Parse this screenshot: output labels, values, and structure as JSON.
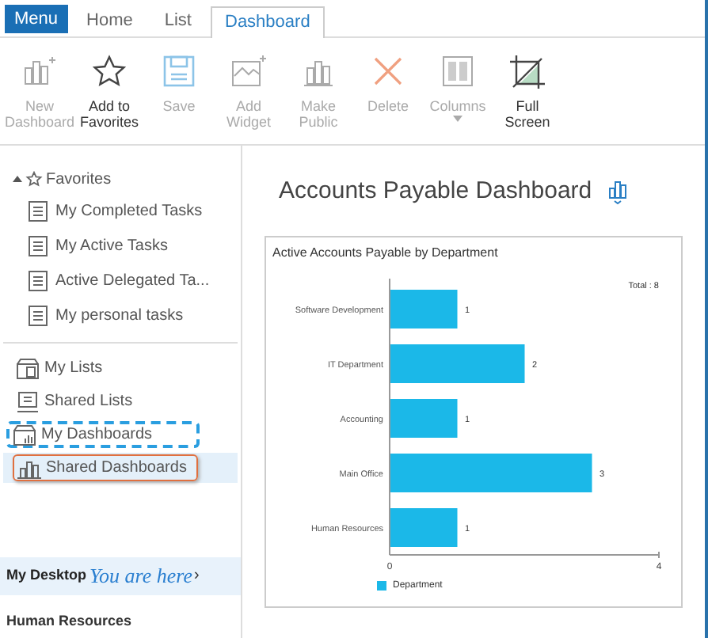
{
  "tabs": [
    {
      "label": "Menu",
      "kind": "menu",
      "selected": false
    },
    {
      "label": "Home",
      "kind": "tab",
      "selected": false
    },
    {
      "label": "List",
      "kind": "tab",
      "selected": false
    },
    {
      "label": "Dashboard",
      "kind": "tab",
      "selected": true
    }
  ],
  "toolbar": [
    {
      "label": "New Dashboard",
      "disabled": true
    },
    {
      "label": "Add to Favorites",
      "disabled": false
    },
    {
      "label": "Save",
      "disabled": true
    },
    {
      "label": "Add Widget",
      "disabled": true
    },
    {
      "label": "Make Public",
      "disabled": true
    },
    {
      "label": "Delete",
      "disabled": true
    },
    {
      "label": "Columns",
      "disabled": true,
      "dropdown": true
    },
    {
      "label": "Full Screen",
      "disabled": false
    }
  ],
  "sidebar": {
    "favorites": {
      "label": "Favorites",
      "expanded": true,
      "items": [
        "My Completed Tasks",
        "My Active Tasks",
        "Active Delegated Ta...",
        "My personal tasks"
      ]
    },
    "items": [
      {
        "label": "My Lists",
        "selected": false
      },
      {
        "label": "Shared Lists",
        "selected": false
      },
      {
        "label": "My Dashboards",
        "selected": false,
        "highlighted": true
      },
      {
        "label": "Shared Dashboards",
        "selected": true
      }
    ],
    "desktop": {
      "label": "My Desktop",
      "note": "You are here",
      "chevron": "›"
    },
    "section": "Human Resources"
  },
  "main": {
    "title": "Accounts Payable Dashboard",
    "widget": {
      "chart_data": {
        "type": "bar",
        "orientation": "horizontal",
        "title": "Active Accounts Payable by Department",
        "categories": [
          "Software Development",
          "IT Department",
          "Accounting",
          "Main Office",
          "Human Resources"
        ],
        "series": [
          {
            "name": "Department",
            "color": "#1bb8e8",
            "values": [
              1,
              2,
              1,
              3,
              1
            ]
          }
        ],
        "xlim": [
          0,
          4
        ],
        "xticks": [
          0,
          4
        ],
        "data_labels": true,
        "annotations": [
          "Total : 8"
        ]
      }
    }
  }
}
